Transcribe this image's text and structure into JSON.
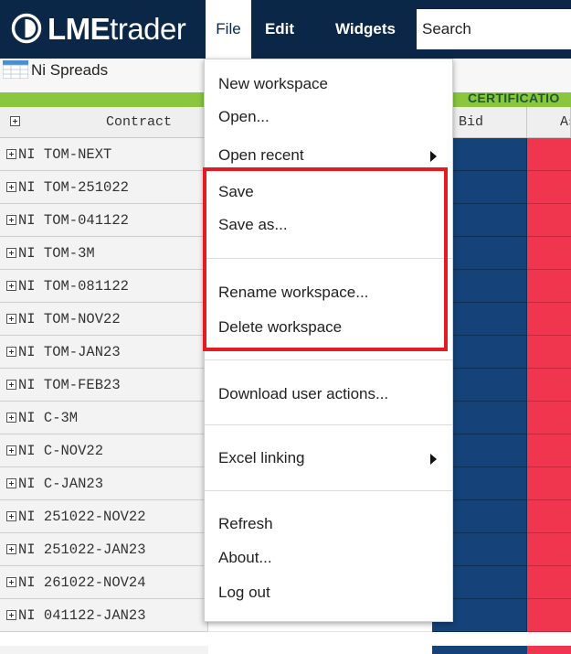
{
  "app": {
    "logo_bold": "LME",
    "logo_regular": "trader",
    "menu": {
      "file": "File",
      "edit": "Edit",
      "widgets": "Widgets"
    },
    "search_placeholder": "Search"
  },
  "widget": {
    "title": "Ni Spreads",
    "group_label": "CERTIFICATIO",
    "columns": {
      "contract": "Contract",
      "bid": "Bid",
      "ask": "As"
    },
    "rows": [
      "NI TOM-NEXT",
      "NI TOM-251022",
      "NI TOM-041122",
      "NI TOM-3M",
      "NI TOM-081122",
      "NI TOM-NOV22",
      "NI TOM-JAN23",
      "NI TOM-FEB23",
      "NI C-3M",
      "NI C-NOV22",
      "NI C-JAN23",
      "NI 251022-NOV22",
      "NI 251022-JAN23",
      "NI 261022-NOV24",
      "NI 041122-JAN23"
    ]
  },
  "file_menu": {
    "new_workspace": "New workspace",
    "open": "Open...",
    "open_recent": "Open recent",
    "save": "Save",
    "save_as": "Save as...",
    "rename_workspace": "Rename workspace...",
    "delete_workspace": "Delete workspace",
    "download_user_actions": "Download user actions...",
    "excel_linking": "Excel linking",
    "refresh": "Refresh",
    "about": "About...",
    "log_out": "Log out"
  },
  "colors": {
    "topbar": "#0b2747",
    "bid_cell": "#154278",
    "ask_cell": "#f0364f",
    "group_bar": "#8cc63f",
    "highlight": "#e31b23"
  }
}
